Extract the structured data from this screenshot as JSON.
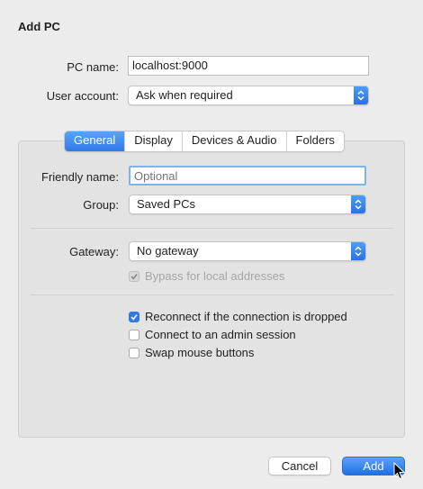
{
  "dialog": {
    "title": "Add PC"
  },
  "form": {
    "pc_name_label": "PC name:",
    "pc_name_value": "localhost:9000",
    "user_account_label": "User account:",
    "user_account_value": "Ask when required"
  },
  "tabs": [
    {
      "label": "General",
      "active": true
    },
    {
      "label": "Display",
      "active": false
    },
    {
      "label": "Devices & Audio",
      "active": false
    },
    {
      "label": "Folders",
      "active": false
    }
  ],
  "general": {
    "friendly_name_label": "Friendly name:",
    "friendly_name_placeholder": "Optional",
    "group_label": "Group:",
    "group_value": "Saved PCs",
    "gateway_label": "Gateway:",
    "gateway_value": "No gateway",
    "bypass_label": "Bypass for local addresses",
    "bypass_checked": true,
    "bypass_disabled": true,
    "reconnect_label": "Reconnect if the connection is dropped",
    "reconnect_checked": true,
    "admin_label": "Connect to an admin session",
    "admin_checked": false,
    "swap_label": "Swap mouse buttons",
    "swap_checked": false
  },
  "buttons": {
    "cancel": "Cancel",
    "add": "Add"
  },
  "colors": {
    "accent": "#2f7ae6",
    "background": "#ececec",
    "panel": "#e3e3e3"
  }
}
